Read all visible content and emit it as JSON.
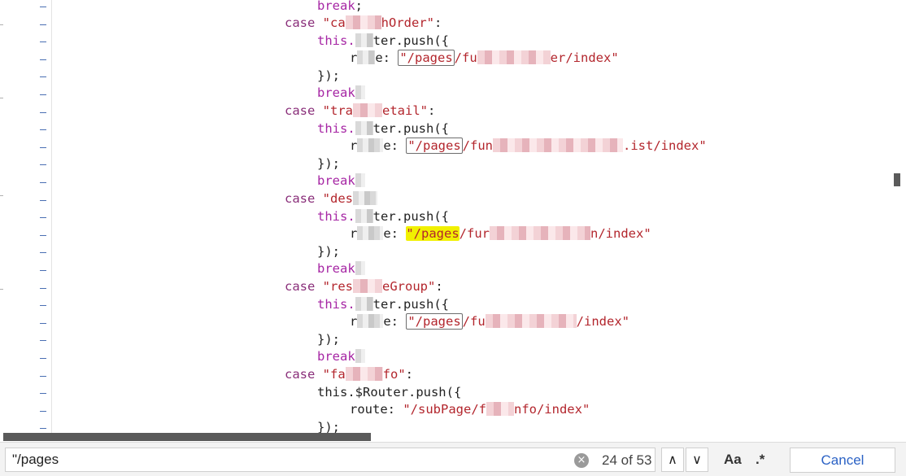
{
  "code": {
    "lines": {
      "l0": {
        "kw": "break",
        "tail": ";"
      },
      "l1": {
        "kw": "case",
        "str_a": "\"ca",
        "str_b": "hOrder\"",
        "tail": ":"
      },
      "l2": {
        "a": "this.",
        "b": "ter.push({"
      },
      "l3": {
        "a": "r",
        "b": "e: ",
        "m": "\"/pages",
        "s1": "/fu",
        "s2": "er/index\""
      },
      "l4": {
        "a": "});"
      },
      "l5": {
        "kw": "break"
      },
      "l6": {
        "kw": "case",
        "str_a": "\"tra",
        "str_b": "etail\"",
        "tail": ":"
      },
      "l7": {
        "a": "this.",
        "b": "ter.push({"
      },
      "l8": {
        "a": "r",
        "b": "e: ",
        "m": "\"/pages",
        "s1": "/fun",
        "s2": ".ist/index\""
      },
      "l9": {
        "a": "});"
      },
      "l10": {
        "kw": "break"
      },
      "l11": {
        "kw": "case",
        "str_a": "\"des"
      },
      "l12": {
        "a": "this.",
        "b": "ter.push({"
      },
      "l13": {
        "a": "r",
        "b": "e: ",
        "m": "\"/pages",
        "s1": "/fur",
        "s2": "n/index\""
      },
      "l14": {
        "a": "});"
      },
      "l15": {
        "kw": "break"
      },
      "l16": {
        "kw": "case",
        "str_a": "\"res",
        "str_b": "eGroup\"",
        "tail": ":"
      },
      "l17": {
        "a": "this.",
        "b": "ter.push({"
      },
      "l18": {
        "a": "r",
        "b": "e: ",
        "m": "\"/pages",
        "s1": "/fu",
        "s2": "/index\""
      },
      "l19": {
        "a": "});"
      },
      "l20": {
        "kw": "break"
      },
      "l21": {
        "kw": "case",
        "str_a": "\"fa",
        "str_b": "fo\"",
        "tail": ":"
      },
      "l22": {
        "a": "this.$Router.push({"
      },
      "l23": {
        "a": "route: ",
        "s1": "\"/subPage/f",
        "s2": "nfo/index\""
      },
      "l24": {
        "a": "});"
      }
    },
    "gutter_mark": "-"
  },
  "find": {
    "query": "\"/pages",
    "clear_icon": "×",
    "count": "24 of 53",
    "prev_icon": "∧",
    "next_icon": "∨",
    "match_case_label": "Aa",
    "regex_label": ".*",
    "cancel_label": "Cancel"
  },
  "colors": {
    "keyword": "#a626a4",
    "string": "#b3262d",
    "highlight": "#f1f000",
    "link": "#2b62c5"
  }
}
